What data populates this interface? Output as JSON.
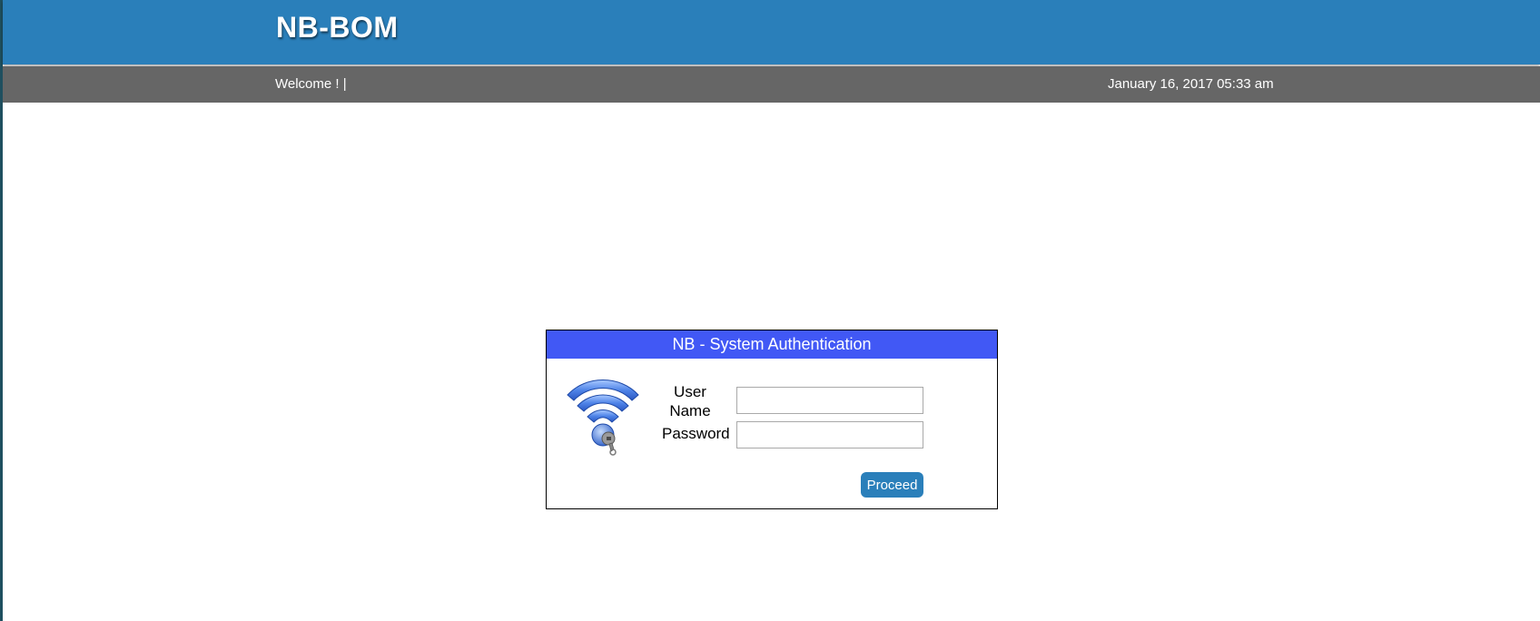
{
  "header": {
    "app_title": "NB-BOM",
    "welcome_text": "Welcome ! |",
    "datetime": "January 16, 2017 05:33 am"
  },
  "auth": {
    "title": "NB - System Authentication",
    "user_label_line1": "User",
    "user_label_line2": "Name",
    "password_label": "Password",
    "username_value": "",
    "password_value": "",
    "proceed_label": "Proceed",
    "icon": "wifi-key-icon"
  },
  "colors": {
    "header_bg": "#2a7fba",
    "subbar_bg": "#666666",
    "auth_header_bg": "#4158f5",
    "button_bg": "#2a7fba"
  }
}
